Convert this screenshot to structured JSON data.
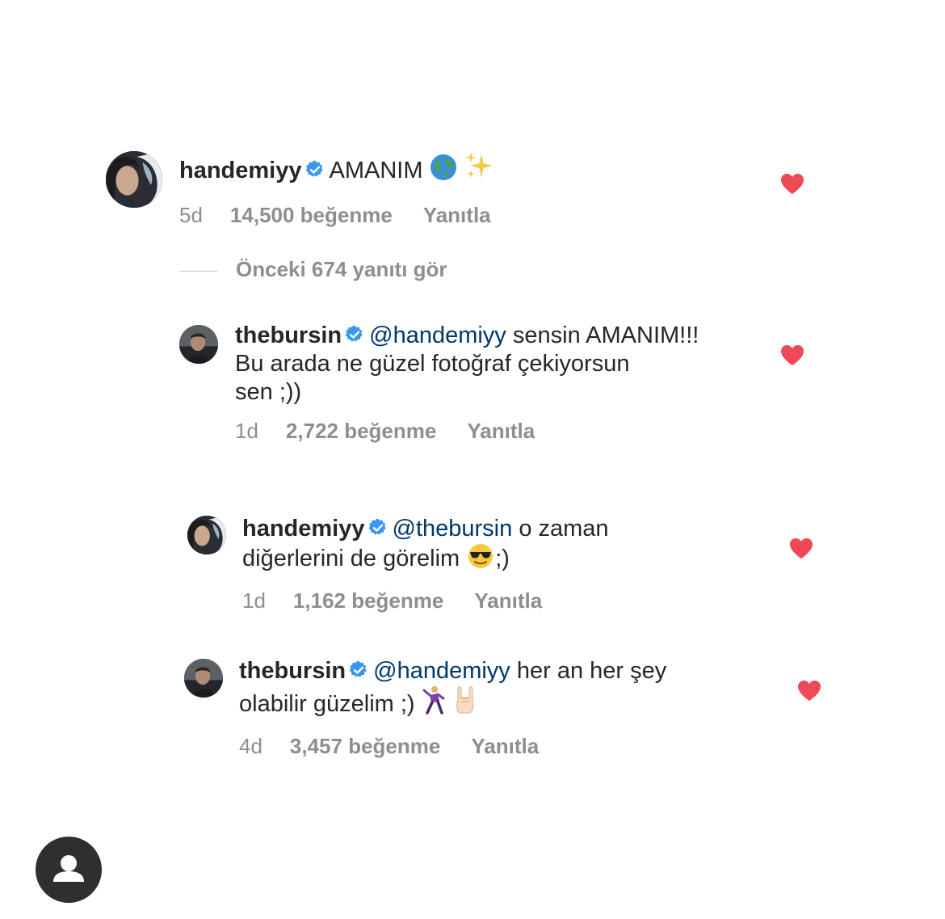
{
  "comments": [
    {
      "username": "handemiyy",
      "mention": "",
      "lines": [
        "AMANIM"
      ],
      "time": "5d",
      "likes": "14,500 beğenme",
      "reply": "Yanıtla",
      "emoji": [
        "globe-icon",
        "sparkles-icon"
      ]
    },
    {
      "username": "thebursin",
      "mention": "@handemiyy",
      "lines": [
        "sensin AMANIM!!!",
        "Bu arada ne güzel fotoğraf çekiyorsun",
        "sen ;))"
      ],
      "time": "1d",
      "likes": "2,722 beğenme",
      "reply": "Yanıtla"
    },
    {
      "username": "handemiyy",
      "mention": "@thebursin",
      "lines": [
        "o zaman",
        "diğerlerini de görelim",
        ";)"
      ],
      "time": "1d",
      "likes": "1,162 beğenme",
      "reply": "Yanıtla",
      "emoji": [
        "sunglasses-face-icon"
      ]
    },
    {
      "username": "thebursin",
      "mention": "@handemiyy",
      "lines": [
        "her an her şey",
        "olabilir güzelim ;)"
      ],
      "time": "4d",
      "likes": "3,457 beğenme",
      "reply": "Yanıtla",
      "emoji": [
        "dancing-man-icon",
        "sign-of-horns-icon"
      ]
    }
  ],
  "view_replies": "Önceki 674 yanıtı gör",
  "colors": {
    "heart": "#ed4956",
    "verified": "#3897f0",
    "mention": "#00376b",
    "meta": "#8e8e8e"
  },
  "icons": [
    "heart-icon",
    "verified-badge-icon",
    "profile-icon"
  ]
}
